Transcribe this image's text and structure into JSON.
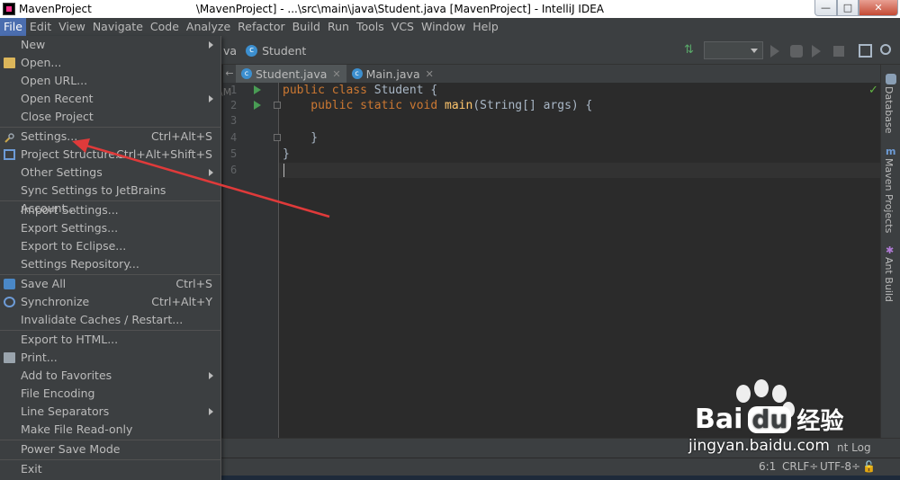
{
  "window": {
    "title_left": "MavenProject",
    "title_right": "\\MavenProject] - ...\\src\\main\\java\\Student.java [MavenProject] - IntelliJ IDEA",
    "min": "—",
    "max": "□",
    "close": "✕"
  },
  "menubar": [
    "File",
    "Edit",
    "View",
    "Navigate",
    "Code",
    "Analyze",
    "Refactor",
    "Build",
    "Run",
    "Tools",
    "VCS",
    "Window",
    "Help"
  ],
  "toolbar": {
    "crumb_prefix": "va",
    "crumb_class": "Student",
    "class_icon_letter": "c"
  },
  "tabs": [
    {
      "label": "Student.java",
      "active": true
    },
    {
      "label": "Main.java",
      "active": false
    }
  ],
  "editor": {
    "gutter_label": "\\M",
    "line_numbers": [
      "1",
      "2",
      "3",
      "4",
      "5",
      "6"
    ],
    "code": {
      "l1_kw": "public class ",
      "l1_tx": "Student {",
      "l2_kw": "    public static void ",
      "l2_fn": "main",
      "l2_tx": "(String[] args) {",
      "l4_tx": "    }",
      "l5_tx": "}"
    }
  },
  "right_tools": [
    "Database",
    "Maven Projects",
    "Ant Build"
  ],
  "file_menu": {
    "new": "New",
    "open": "Open...",
    "open_url": "Open URL...",
    "open_recent": "Open Recent",
    "close_project": "Close Project",
    "settings": "Settings...",
    "settings_sc": "Ctrl+Alt+S",
    "project_structure": "Project Structure...",
    "project_structure_sc": "Ctrl+Alt+Shift+S",
    "other_settings": "Other Settings",
    "sync_settings": "Sync Settings to JetBrains Account...",
    "import_settings": "Import Settings...",
    "export_settings": "Export Settings...",
    "export_eclipse": "Export to Eclipse...",
    "settings_repo": "Settings Repository...",
    "save_all": "Save All",
    "save_all_sc": "Ctrl+S",
    "synchronize": "Synchronize",
    "synchronize_sc": "Ctrl+Alt+Y",
    "invalidate": "Invalidate Caches / Restart...",
    "export_html": "Export to HTML...",
    "print": "Print...",
    "add_favorites": "Add to Favorites",
    "file_encoding": "File Encoding",
    "line_separators": "Line Separators",
    "read_only": "Make File Read-only",
    "power_save": "Power Save Mode",
    "exit": "Exit"
  },
  "status": {
    "position": "6:1",
    "line_sep": "CRLF÷",
    "encoding": "UTF-8÷",
    "event_log": "nt Log"
  },
  "watermark": {
    "brand": "Bai",
    "brand2": "du",
    "cn": "经验",
    "url": "jingyan.baidu.com"
  },
  "colors": {
    "accent": "#4b6eaf",
    "arrow": "#e03a3a",
    "keyword": "#cc7832",
    "function": "#ffc66d"
  }
}
